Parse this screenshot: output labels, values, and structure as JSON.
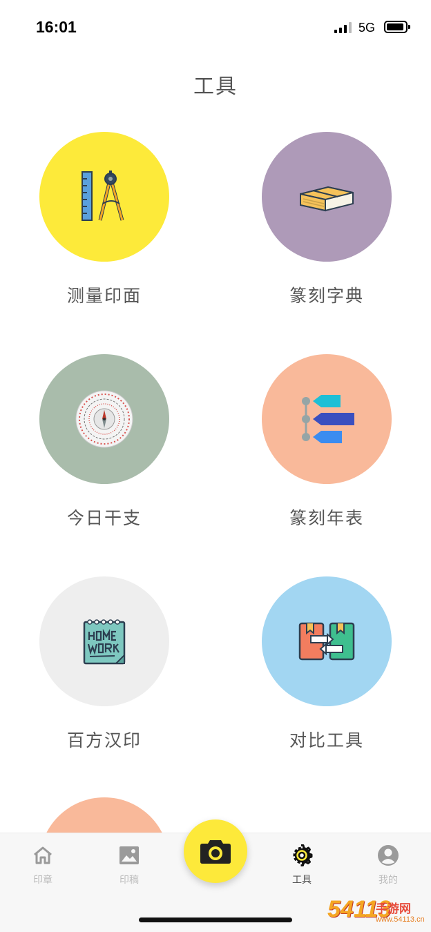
{
  "status_bar": {
    "time": "16:01",
    "network": "5G"
  },
  "page": {
    "title": "工具"
  },
  "tools": [
    {
      "label": "测量印面",
      "color": "#fdea3a",
      "icon": "ruler-compass-icon"
    },
    {
      "label": "篆刻字典",
      "color": "#ae9ab8",
      "icon": "book-icon"
    },
    {
      "label": "今日干支",
      "color": "#a9bcab",
      "icon": "luopan-compass-icon"
    },
    {
      "label": "篆刻年表",
      "color": "#f9b99a",
      "icon": "timeline-tags-icon"
    },
    {
      "label": "百方汉印",
      "color": "#eeeeee",
      "icon": "homework-notebook-icon"
    },
    {
      "label": "对比工具",
      "color": "#a2d6f2",
      "icon": "compare-books-icon"
    }
  ],
  "partial_tool": {
    "color": "#f9b99a"
  },
  "tab_bar": {
    "items": [
      {
        "label": "印章",
        "icon": "home-icon",
        "active": false
      },
      {
        "label": "印稿",
        "icon": "image-icon",
        "active": false
      },
      {
        "label": "工具",
        "icon": "gear-icon",
        "active": true
      },
      {
        "label": "我的",
        "icon": "user-icon",
        "active": false
      }
    ],
    "camera": {
      "icon": "camera-icon",
      "color": "#fde93a"
    }
  },
  "watermark": {
    "number": "54113",
    "text": "手游网",
    "url": "www.54113.cn"
  }
}
